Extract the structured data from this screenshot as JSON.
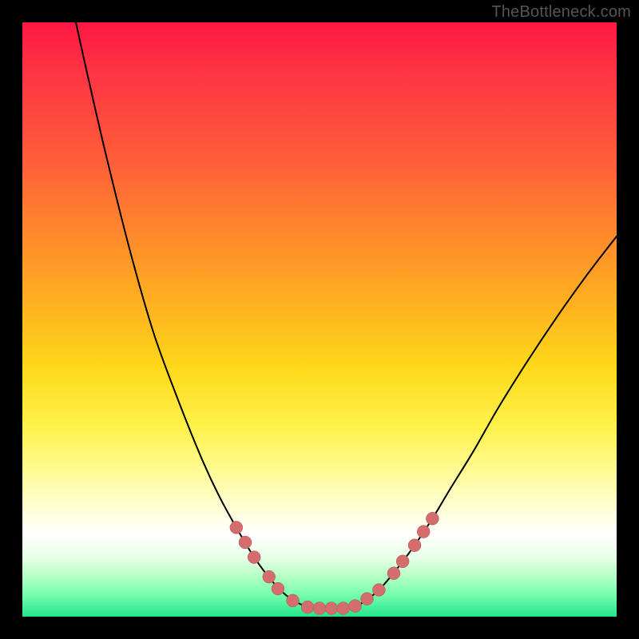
{
  "watermark": "TheBottleneck.com",
  "chart_data": {
    "type": "line",
    "title": "",
    "xlabel": "",
    "ylabel": "",
    "x_range": [
      0,
      100
    ],
    "y_range_percent_from_top": [
      0,
      100
    ],
    "series": [
      {
        "name": "left-curve",
        "points": [
          {
            "x": 9.0,
            "y": 0.0
          },
          {
            "x": 11.0,
            "y": 9.0
          },
          {
            "x": 14.0,
            "y": 22.0
          },
          {
            "x": 18.0,
            "y": 38.0
          },
          {
            "x": 22.0,
            "y": 52.0
          },
          {
            "x": 26.0,
            "y": 63.0
          },
          {
            "x": 30.0,
            "y": 73.0
          },
          {
            "x": 33.0,
            "y": 79.5
          },
          {
            "x": 36.0,
            "y": 85.0
          },
          {
            "x": 39.0,
            "y": 90.0
          },
          {
            "x": 42.0,
            "y": 94.0
          },
          {
            "x": 44.5,
            "y": 96.5
          },
          {
            "x": 47.0,
            "y": 98.0
          },
          {
            "x": 49.0,
            "y": 98.6
          }
        ]
      },
      {
        "name": "flat-bottom",
        "points": [
          {
            "x": 49.0,
            "y": 98.6
          },
          {
            "x": 55.0,
            "y": 98.6
          }
        ]
      },
      {
        "name": "right-curve",
        "points": [
          {
            "x": 55.0,
            "y": 98.6
          },
          {
            "x": 57.0,
            "y": 97.8
          },
          {
            "x": 60.0,
            "y": 95.5
          },
          {
            "x": 63.0,
            "y": 92.0
          },
          {
            "x": 66.0,
            "y": 88.0
          },
          {
            "x": 69.0,
            "y": 83.5
          },
          {
            "x": 72.0,
            "y": 78.5
          },
          {
            "x": 76.0,
            "y": 72.0
          },
          {
            "x": 80.0,
            "y": 65.0
          },
          {
            "x": 85.0,
            "y": 57.0
          },
          {
            "x": 90.0,
            "y": 49.5
          },
          {
            "x": 95.0,
            "y": 42.5
          },
          {
            "x": 100.0,
            "y": 36.0
          }
        ]
      }
    ],
    "markers": [
      {
        "x": 36.0,
        "y": 85.0
      },
      {
        "x": 37.5,
        "y": 87.5
      },
      {
        "x": 39.0,
        "y": 90.0
      },
      {
        "x": 41.5,
        "y": 93.3
      },
      {
        "x": 43.0,
        "y": 95.3
      },
      {
        "x": 45.5,
        "y": 97.3
      },
      {
        "x": 48.0,
        "y": 98.4
      },
      {
        "x": 50.0,
        "y": 98.6
      },
      {
        "x": 52.0,
        "y": 98.6
      },
      {
        "x": 54.0,
        "y": 98.6
      },
      {
        "x": 56.0,
        "y": 98.2
      },
      {
        "x": 58.0,
        "y": 97.0
      },
      {
        "x": 60.0,
        "y": 95.5
      },
      {
        "x": 62.5,
        "y": 92.7
      },
      {
        "x": 64.0,
        "y": 90.7
      },
      {
        "x": 66.0,
        "y": 88.0
      },
      {
        "x": 67.5,
        "y": 85.7
      },
      {
        "x": 69.0,
        "y": 83.5
      }
    ],
    "marker_radius_px": 8,
    "gradient_stops": [
      {
        "pos": 0.0,
        "color": "#ff1744"
      },
      {
        "pos": 0.36,
        "color": "#ff8a2b"
      },
      {
        "pos": 0.58,
        "color": "#ffd81a"
      },
      {
        "pos": 0.82,
        "color": "#ffffd8"
      },
      {
        "pos": 1.0,
        "color": "#22e58c"
      }
    ]
  }
}
